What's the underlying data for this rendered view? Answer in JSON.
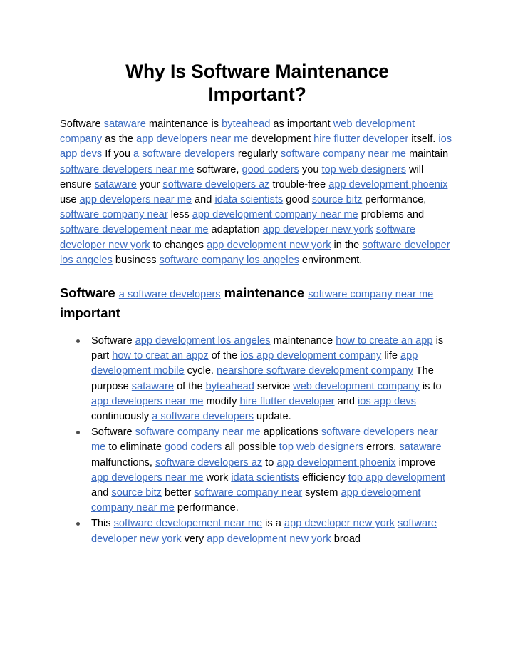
{
  "document": {
    "title_line1": "Why Is Software Maintenance",
    "title_line2": "Important?",
    "title_full": "Why Is Software Maintenance Important?",
    "link_color": "#3a6ac0",
    "text_color": "#000000",
    "background_color": "#ffffff",
    "bullet_color": "#4d4d4d"
  },
  "intro_paragraph": {
    "t1": "Software ",
    "l1": "sataware",
    "t2": " maintenance is ",
    "l2": "byteahead",
    "t3": " as important ",
    "l3": "web development company",
    "t4": " as the ",
    "l4": "app developers near me",
    "t5": " development ",
    "l5": "hire flutter developer",
    "t6": " itself. ",
    "l6": "ios app devs",
    "t7": " If you ",
    "l7": "a software developers",
    "t8": " regularly ",
    "l8": "software company near me",
    "t9": " maintain ",
    "l9": "software developers near me",
    "t10": " software, ",
    "l10": "good coders",
    "t11": " you ",
    "l11": "top web designers",
    "t12": " will ensure ",
    "l12": "sataware",
    "t13": " your ",
    "l13": "software developers az",
    "t14": " trouble-free ",
    "l14": "app development phoenix",
    "t15": " use ",
    "l15": "app developers near me",
    "t16": " and ",
    "l16": "idata scientists",
    "t17": " good ",
    "l17": "source bitz",
    "t18": " performance, ",
    "l18": "software company near",
    "t19": " less ",
    "l19": "app development company near me",
    "t20": " problems and ",
    "l20": "software developement near me",
    "t21": " adaptation ",
    "l21": "app developer new york",
    "t22": " ",
    "l22": "software developer new york",
    "t23": " to changes ",
    "l23": "app development new york",
    "t24": " in the ",
    "l24": "software developer los angeles",
    "t25": " business ",
    "l25": "software company los angeles",
    "t26": " environment."
  },
  "sub_heading": {
    "b1": "Software ",
    "l1": "a software developers",
    "b2": " maintenance ",
    "l2": "software company near me",
    "b3": " important"
  },
  "bullets": [
    {
      "t1": "Software ",
      "l1": "app development los angeles",
      "t2": " maintenance ",
      "l2": "how to create an app",
      "t3": " is part ",
      "l3": "how to creat an appz",
      "t4": " of the ",
      "l4": "ios app development company",
      "t5": " life ",
      "l5": "app development mobile",
      "t6": " cycle. ",
      "l6": "nearshore software development company",
      "t7": " The purpose ",
      "l7": "sataware",
      "t8": " of the ",
      "l8": "byteahead",
      "t9": " service ",
      "l9": "web development company",
      "t10": " is to ",
      "l10": "app developers near me",
      "t11": " modify ",
      "l11": "hire flutter developer",
      "t12": " and ",
      "l12": "ios app devs",
      "t13": " continuously ",
      "l13": "a software developers",
      "t14": " update."
    },
    {
      "t1": "Software ",
      "l1": "software company near me",
      "t2": " applications ",
      "l2": "software developers near me",
      "t3": " to eliminate ",
      "l3": "good coders",
      "t4": " all possible ",
      "l4": "top web designers",
      "t5": " errors, ",
      "l5": "sataware",
      "t6": " malfunctions, ",
      "l6": "software developers az",
      "t7": " to ",
      "l7": "app development phoenix",
      "t8": " improve ",
      "l8": "app developers near me",
      "t9": " work ",
      "l9": "idata scientists",
      "t10": " efficiency ",
      "l10": "top app development",
      "t11": " and ",
      "l11": "source bitz",
      "t12": " better ",
      "l12": "software company near",
      "t13": " system ",
      "l13": "app development company near me",
      "t14": " performance."
    },
    {
      "t1": "This ",
      "l1": "software developement near me",
      "t2": " is a ",
      "l2": "app developer new york",
      "t3": " ",
      "l3": "software developer new york",
      "t4": " very ",
      "l4": "app development new york",
      "t5": " broad"
    }
  ]
}
